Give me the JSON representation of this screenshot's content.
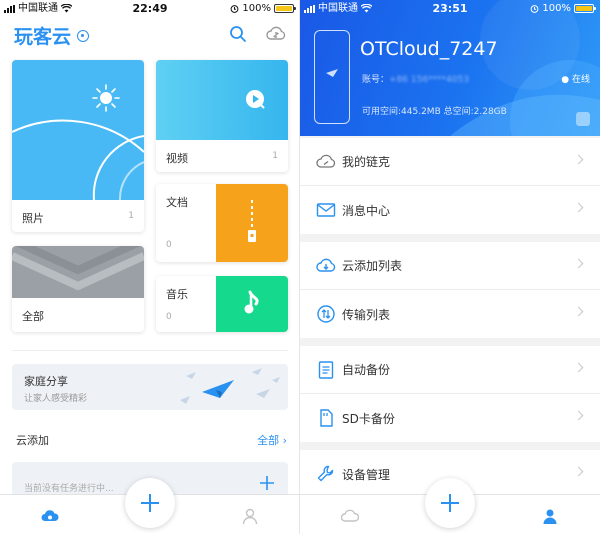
{
  "colors": {
    "accent": "#2a91f0",
    "video": "#35b6ee",
    "docs": "#f7a21b",
    "music": "#15d98c",
    "header_blue": "#1b73f0"
  },
  "left": {
    "status": {
      "carrier": "中国联通",
      "time": "22:49",
      "battery": "100%"
    },
    "app_title": "玩客云",
    "cards": {
      "photos": {
        "label": "照片",
        "count": "1"
      },
      "videos": {
        "label": "视频",
        "count": "1"
      },
      "all": {
        "label": "全部"
      },
      "docs": {
        "label": "文档",
        "count": "0"
      },
      "music": {
        "label": "音乐",
        "count": "0"
      }
    },
    "family_share": {
      "title": "家庭分享",
      "subtitle": "让家人感受精彩"
    },
    "cloud_add": {
      "title": "云添加",
      "all_link": "全部"
    },
    "task_empty": "当前没有任务进行中..."
  },
  "right": {
    "status": {
      "carrier": "中国联通",
      "time": "23:51",
      "battery": "100%"
    },
    "device_name": "OTCloud_7247",
    "account_label": "账号：",
    "account_value": "+86 156****4053",
    "online": "在线",
    "space": "可用空间:445.2MB 总空间:2.28GB",
    "menu": {
      "my_links": "我的链克",
      "messages": "消息中心",
      "cloud_add_list": "云添加列表",
      "transfer_list": "传输列表",
      "auto_backup": "自动备份",
      "sd_backup": "SD卡备份",
      "device_manage": "设备管理"
    }
  }
}
